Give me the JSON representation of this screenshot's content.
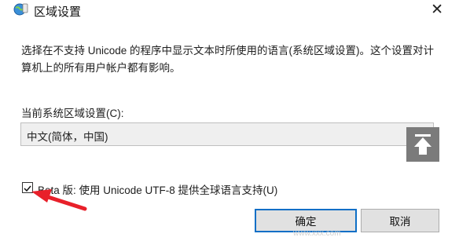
{
  "window": {
    "title": "区域设置",
    "icon": "globe-settings-icon",
    "close_label": "✕"
  },
  "description": "选择在不支持 Unicode 的程序中显示文本时所使用的语言(系统区域设置)。这个设置对计算机上的所有用户帐户都有影响。",
  "locale": {
    "label": "当前系统区域设置(C):",
    "value": "中文(简体，中国)"
  },
  "beta_option": {
    "label": "Beta 版: 使用 Unicode UTF-8 提供全球语言支持(U)",
    "checked": true
  },
  "buttons": {
    "ok": "确定",
    "cancel": "取消"
  },
  "overlay": {
    "scroll_top_icon": "scroll-to-top-icon",
    "arrow_color": "#e8202a"
  },
  "watermark": "www.xxx.com"
}
